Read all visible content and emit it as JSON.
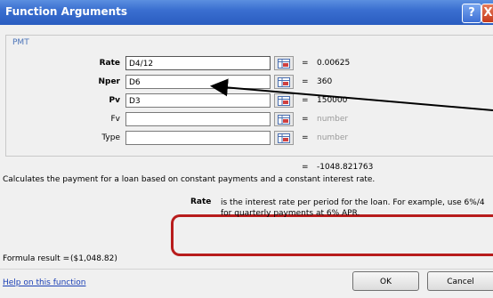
{
  "window": {
    "title": "Function Arguments",
    "help_glyph": "?",
    "close_glyph": "X"
  },
  "group_label": "PMT",
  "args": [
    {
      "label": "Rate",
      "bold": true,
      "input": "D4/12",
      "value": "0.00625"
    },
    {
      "label": "Nper",
      "bold": true,
      "input": "D6",
      "value": "360"
    },
    {
      "label": "Pv",
      "bold": true,
      "input": "D3",
      "value": "150000"
    },
    {
      "label": "Fv",
      "bold": false,
      "input": "",
      "value": "number"
    },
    {
      "label": "Type",
      "bold": false,
      "input": "",
      "value": "number"
    }
  ],
  "equals": "=",
  "result_value": "-1048.821763",
  "description": "Calculates the payment for a loan based on constant payments and a constant interest rate.",
  "help": {
    "arg_name": "Rate",
    "text": "is the interest rate per period for the loan. For example, use 6%/4 for quarterly payments at 6% APR."
  },
  "formula_label": "Formula result =",
  "formula_value": "($1,048.82)",
  "help_link": "Help on this function",
  "buttons": {
    "ok": "OK",
    "cancel": "Cancel"
  },
  "colors": {
    "annotation_red": "#b81c1c",
    "title_blue": "#3a6fd0"
  }
}
